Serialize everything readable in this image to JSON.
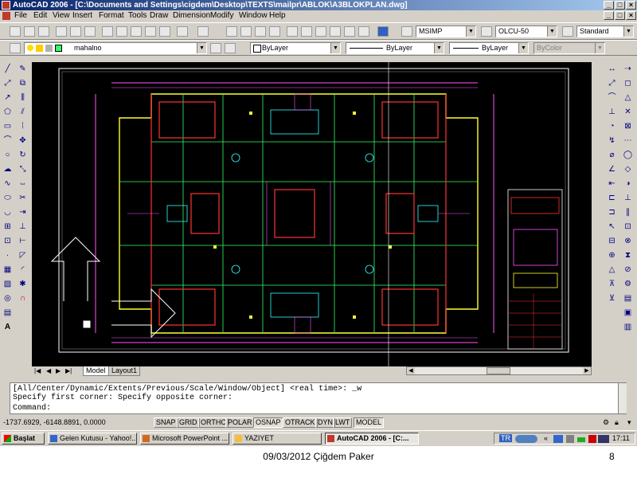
{
  "window": {
    "title": "AutoCAD 2006 - [C:\\Documents and Settings\\cigdem\\Desktop\\TEXTS\\mailpr\\ABLOK\\A3BLOKPLAN.dwg]",
    "controls": [
      "_",
      "□",
      "×"
    ]
  },
  "menu": {
    "items": [
      "File",
      "Edit",
      "View",
      "Insert",
      "Format",
      "Tools",
      "Draw",
      "Dimension",
      "Modify",
      "Window",
      "Help"
    ],
    "doc_controls": [
      "_",
      "□",
      "×"
    ]
  },
  "styles_toolbar": {
    "text_style": "MSIMP",
    "dim_style": "OLCU-50",
    "table_style": "Standard"
  },
  "layers_toolbar": {
    "current_layer": "mahalno",
    "color": "ByLayer",
    "linetype": "ByLayer",
    "lineweight": "ByLayer",
    "plot_style": "ByColor"
  },
  "layout_tabs": [
    "Model",
    "Layout1"
  ],
  "command": {
    "history": [
      "[All/Center/Dynamic/Extents/Previous/Scale/Window/Object] <real time>: _w",
      "Specify first corner: Specify opposite corner:"
    ],
    "prompt": "Command:"
  },
  "status": {
    "coords": "-1737.6929, -6148.8891, 0.0000",
    "toggles": [
      "SNAP",
      "GRID",
      "ORTHO",
      "POLAR",
      "OSNAP",
      "OTRACK",
      "DYN",
      "LWT",
      "MODEL"
    ],
    "active_toggles": [
      "OSNAP",
      "MODEL"
    ]
  },
  "taskbar": {
    "start": "Başlat",
    "tasks": [
      "Gelen Kutusu - Yahoo!...",
      "Microsoft PowerPoint ...",
      "YAZIYET",
      "AutoCAD 2006 - [C:..."
    ],
    "lang": "TR",
    "clock": "17:11"
  },
  "slide": {
    "date_author": "09/03/2012 Çiğdem Paker",
    "page": "8"
  },
  "colors": {
    "title_start": "#0a246a",
    "title_end": "#a6caf0",
    "canvas": "#000000",
    "wall_red": "#ff3333",
    "wall_yellow": "#ffff33",
    "line_magenta": "#ff55ff",
    "line_green": "#33ff66",
    "line_cyan": "#33ffff"
  }
}
